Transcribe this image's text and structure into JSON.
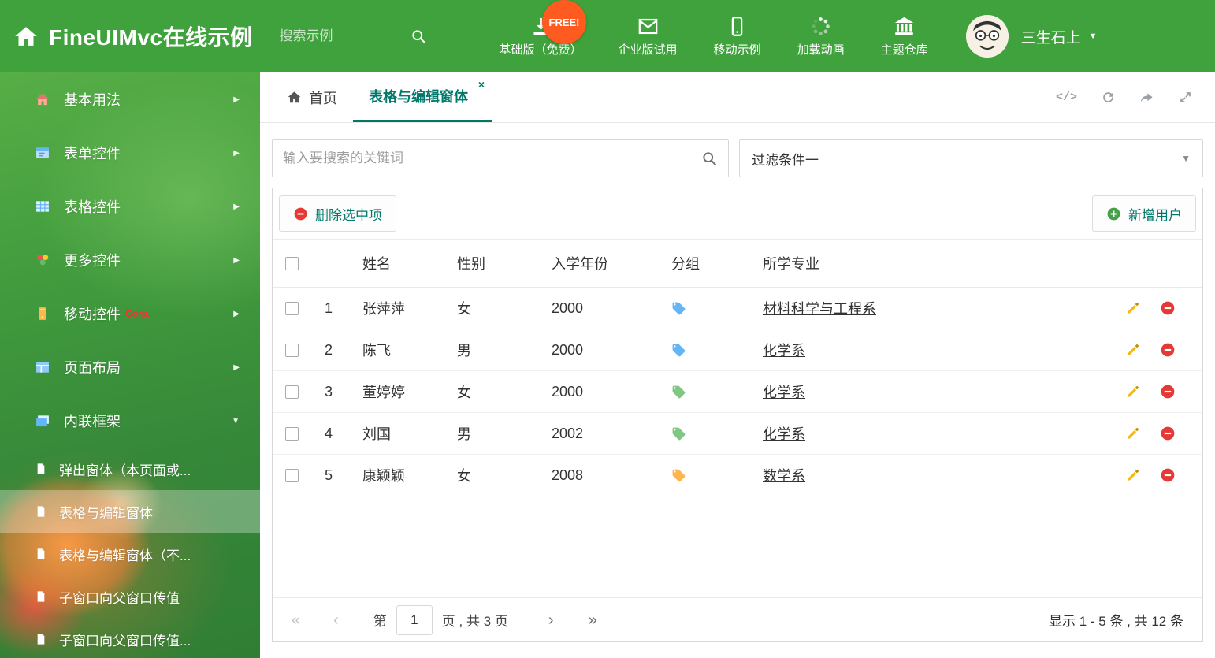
{
  "header": {
    "title": "FineUIMvc在线示例",
    "search_placeholder": "搜索示例",
    "free_badge": "FREE!",
    "nav_items": [
      {
        "label": "基础版（免费）",
        "icon": "download-icon"
      },
      {
        "label": "企业版试用",
        "icon": "envelope-icon"
      },
      {
        "label": "移动示例",
        "icon": "mobile-icon"
      },
      {
        "label": "加载动画",
        "icon": "spinner-icon"
      },
      {
        "label": "主题仓库",
        "icon": "bank-icon"
      }
    ],
    "user_name": "三生石上"
  },
  "sidebar": {
    "items": [
      {
        "label": "基本用法",
        "icon": "home-icon"
      },
      {
        "label": "表单控件",
        "icon": "form-icon"
      },
      {
        "label": "表格控件",
        "icon": "table-icon"
      },
      {
        "label": "更多控件",
        "icon": "widgets-icon"
      },
      {
        "label": "移动控件",
        "badge": "Corp.",
        "icon": "mobile-icon"
      },
      {
        "label": "页面布局",
        "icon": "layout-icon"
      },
      {
        "label": "内联框架",
        "icon": "frame-icon",
        "expanded": true
      }
    ],
    "subitems": [
      {
        "label": "弹出窗体（本页面或..."
      },
      {
        "label": "表格与编辑窗体",
        "selected": true
      },
      {
        "label": "表格与编辑窗体（不..."
      },
      {
        "label": "子窗口向父窗口传值"
      },
      {
        "label": "子窗口向父窗口传值..."
      }
    ]
  },
  "tabs": [
    {
      "label": "首页"
    },
    {
      "label": "表格与编辑窗体",
      "active": true
    }
  ],
  "filter": {
    "search_placeholder": "输入要搜索的关键词",
    "dropdown_value": "过滤条件一"
  },
  "table": {
    "delete_button": "删除选中项",
    "add_button": "新增用户",
    "columns": [
      "姓名",
      "性别",
      "入学年份",
      "分组",
      "所学专业"
    ],
    "rows": [
      {
        "index": "1",
        "name": "张萍萍",
        "gender": "女",
        "year": "2000",
        "tag_color": "#64b5f6",
        "major": "材料科学与工程系"
      },
      {
        "index": "2",
        "name": "陈飞",
        "gender": "男",
        "year": "2000",
        "tag_color": "#64b5f6",
        "major": "化学系"
      },
      {
        "index": "3",
        "name": "董婷婷",
        "gender": "女",
        "year": "2000",
        "tag_color": "#81c784",
        "major": "化学系"
      },
      {
        "index": "4",
        "name": "刘国",
        "gender": "男",
        "year": "2002",
        "tag_color": "#81c784",
        "major": "化学系"
      },
      {
        "index": "5",
        "name": "康颖颖",
        "gender": "女",
        "year": "2008",
        "tag_color": "#ffb74d",
        "major": "数学系"
      }
    ]
  },
  "pagination": {
    "page_prefix": "第",
    "current_page": "1",
    "page_suffix": "页 , 共 3 页",
    "summary": "显示 1 - 5 条 , 共 12 条"
  },
  "icons": {
    "caret_down": "▼",
    "arrow_right": "▶",
    "close": "×",
    "code": "</>",
    "page_first": "«",
    "page_prev": "‹",
    "page_next": "›",
    "page_last": "»"
  },
  "colors": {
    "brand_green": "#3fa23c",
    "accent_teal": "#00796b",
    "danger_red": "#e53935",
    "success_green": "#43a047",
    "pencil_yellow": "#f5b80c",
    "free_badge_orange": "#ff5a1f"
  }
}
